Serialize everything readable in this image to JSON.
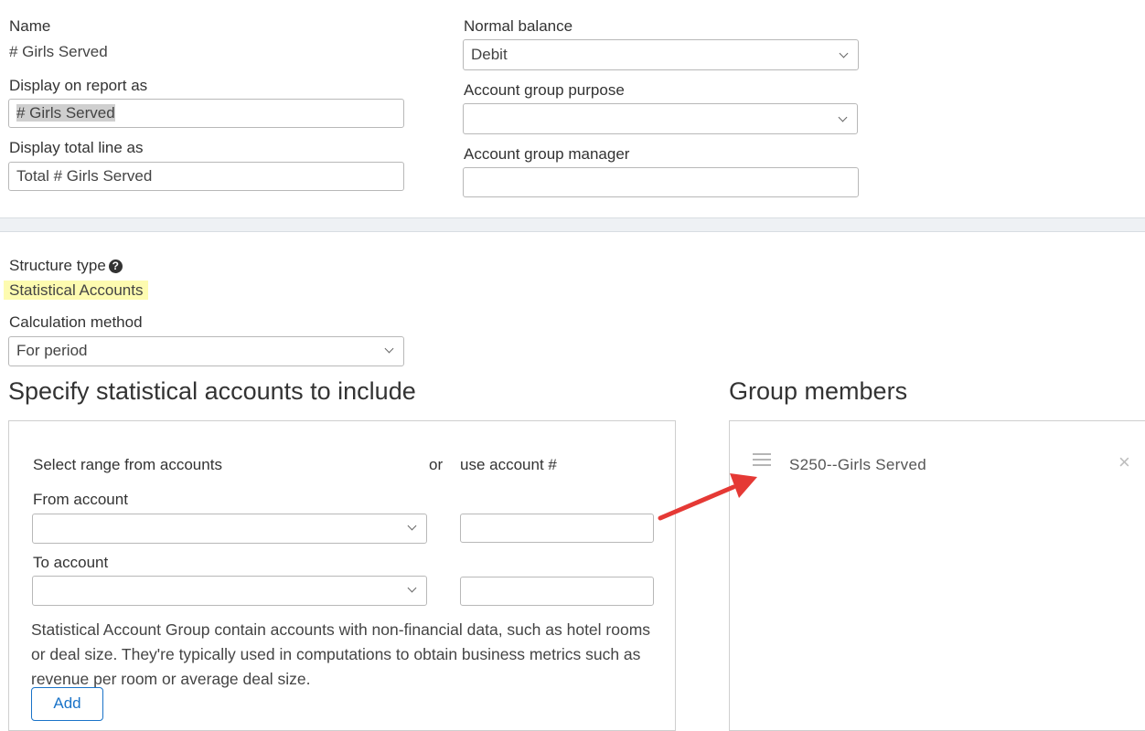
{
  "form": {
    "name_label": "Name",
    "name_value": "# Girls Served",
    "display_on_report_label": "Display on report as",
    "display_on_report_value": "# Girls Served",
    "display_total_label": "Display total line as",
    "display_total_value": "Total # Girls Served",
    "normal_balance_label": "Normal balance",
    "normal_balance_value": "Debit",
    "purpose_label": "Account group purpose",
    "purpose_value": "",
    "manager_label": "Account group manager",
    "manager_value": ""
  },
  "structure": {
    "type_label": "Structure type",
    "help_icon": "?",
    "type_value": "Statistical Accounts",
    "calc_label": "Calculation method",
    "calc_value": "For period"
  },
  "specify": {
    "heading": "Specify statistical accounts to include",
    "select_range_label": "Select range from accounts",
    "or_label": "or",
    "use_account_label": "use account #",
    "from_label": "From account",
    "to_label": "To account",
    "from_value": "",
    "to_value": "",
    "from_number": "",
    "to_number": "",
    "description": "Statistical Account Group contain accounts with non-financial data, such as hotel rooms or deal size. They're typically used in computations to obtain business metrics such as revenue per room or average deal size.",
    "add_label": "Add"
  },
  "group_members": {
    "heading": "Group members",
    "items": [
      {
        "label": "S250--Girls Served"
      }
    ],
    "remove_icon": "×"
  },
  "colors": {
    "accent": "#1a73c8",
    "highlight": "#fdfbb0",
    "arrow": "#e53935"
  }
}
